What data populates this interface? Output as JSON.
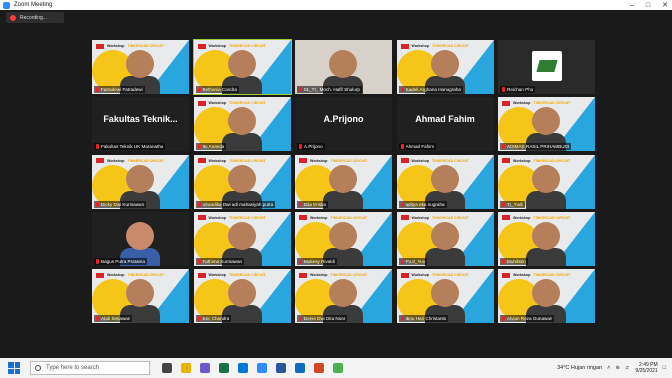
{
  "window": {
    "title": "Zoom Meeting",
    "recording_label": "Recording..."
  },
  "banner": {
    "workshop": "Workshop",
    "event": "TINKERCAD CIRCUIT"
  },
  "tiles": [
    {
      "name": "Fatradewi Fatradewi",
      "type": "banner"
    },
    {
      "name": "Bethania Candra",
      "type": "banner",
      "active": true
    },
    {
      "name": "01_TI_ Moch. Hafif Shulurp",
      "type": "light"
    },
    {
      "name": "Kadek Arghana Hanugraha",
      "type": "banner"
    },
    {
      "name": "Reichan Pho",
      "type": "logo"
    },
    {
      "name": "Fakultas Teknik UK Maranatha",
      "type": "black",
      "big": "Fakultas Teknik..."
    },
    {
      "name": "Ito Ananda",
      "type": "banner"
    },
    {
      "name": "A.Prijono",
      "type": "black",
      "big": "A.Prijono"
    },
    {
      "name": "Ahmad Fahim",
      "type": "black",
      "big": "Ahmad Fahim"
    },
    {
      "name": "ADIMAS RASIL PRIHAMBUDI",
      "type": "banner"
    },
    {
      "name": "Dicky Dwi Kurniawan",
      "type": "banner"
    },
    {
      "name": "Virandika Dwi adi mahasiyah putra",
      "type": "banner"
    },
    {
      "name": "Dila Eriska",
      "type": "banner"
    },
    {
      "name": "aditya eka nugraha",
      "type": "banner"
    },
    {
      "name": "TI_Yudi",
      "type": "banner"
    },
    {
      "name": "Bagus Putra Pratama",
      "type": "black"
    },
    {
      "name": "Fathima Kurniawan",
      "type": "banner"
    },
    {
      "name": "Mukesy Rivaldi",
      "type": "banner"
    },
    {
      "name": "FVJI_Yuv",
      "type": "banner"
    },
    {
      "name": "Muhibbin",
      "type": "banner"
    },
    {
      "name": "Abdi Setiawan",
      "type": "banner"
    },
    {
      "name": "Eric Chandra",
      "type": "banner"
    },
    {
      "name": "Denis Dwi Dita Noor",
      "type": "banner"
    },
    {
      "name": "Ibnu Hari Christanto",
      "type": "banner"
    },
    {
      "name": "Alvian Reza Gunawan",
      "type": "banner"
    }
  ],
  "taskbar": {
    "search_placeholder": "Type here to search",
    "weather": "34°C  Hujan ringan",
    "time": "2:49 PM",
    "date": "9/25/2021"
  },
  "colors": {
    "accent_yellow": "#f5c518",
    "accent_blue": "#2aa6df",
    "active_border": "#9acd32"
  }
}
